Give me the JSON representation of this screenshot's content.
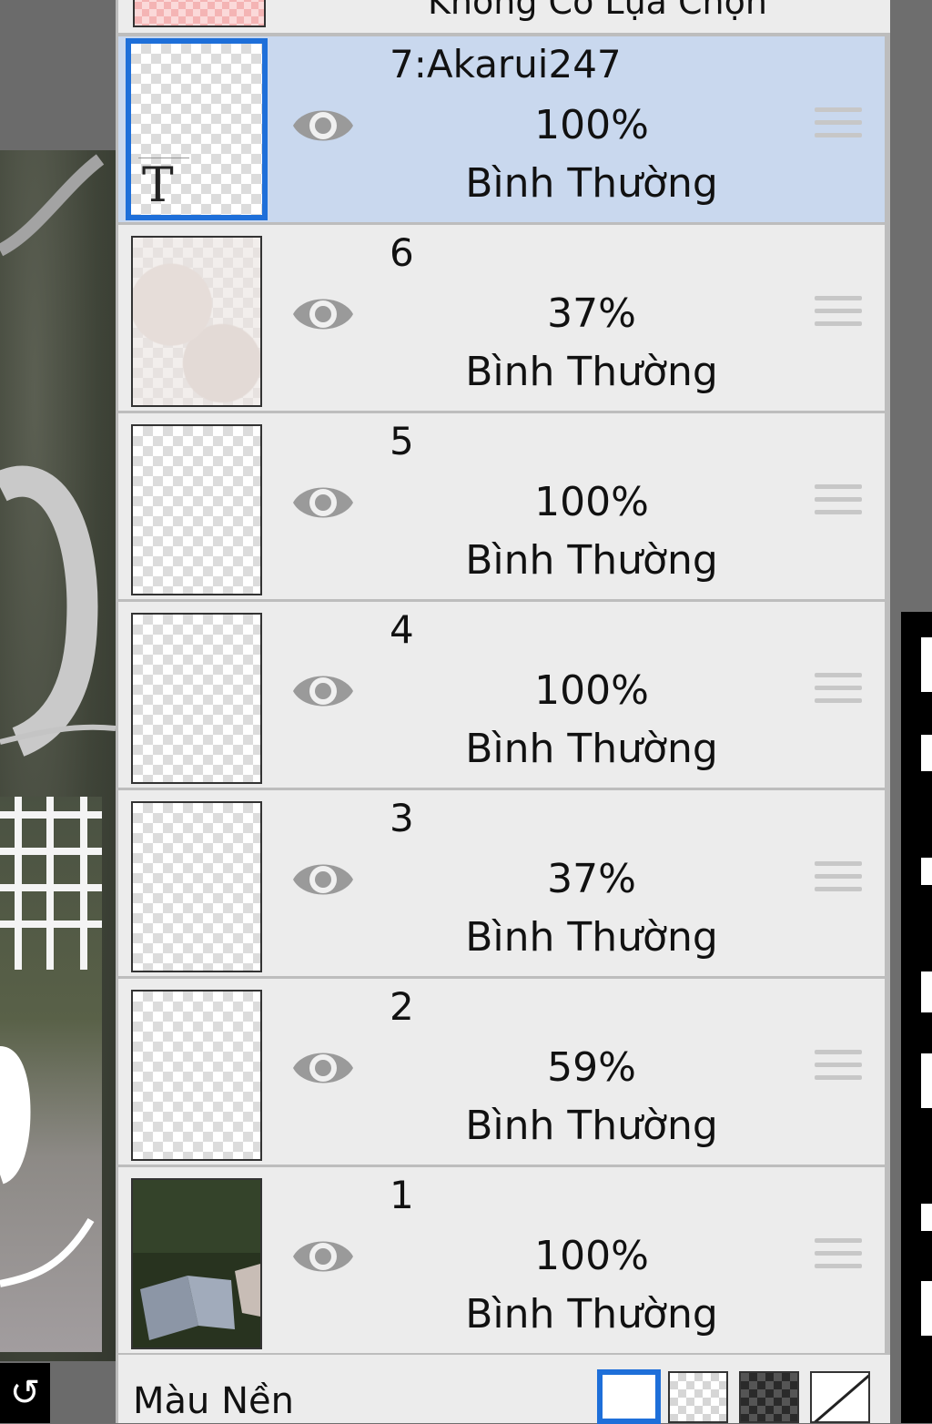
{
  "panel": {
    "selection_row_label": "Không Có Lựa Chọn",
    "layers": [
      {
        "name": "7:Akarui247",
        "opacity": "100%",
        "blend": "Bình Thường",
        "selected": true,
        "thumb": "text-icon",
        "thumb_letter": "T"
      },
      {
        "name": "6",
        "opacity": "37%",
        "blend": "Bình Thường",
        "selected": false,
        "thumb": "cloud"
      },
      {
        "name": "5",
        "opacity": "100%",
        "blend": "Bình Thường",
        "selected": false,
        "thumb": "transparent"
      },
      {
        "name": "4",
        "opacity": "100%",
        "blend": "Bình Thường",
        "selected": false,
        "thumb": "transparent"
      },
      {
        "name": "3",
        "opacity": "37%",
        "blend": "Bình Thường",
        "selected": false,
        "thumb": "transparent"
      },
      {
        "name": "2",
        "opacity": "59%",
        "blend": "Bình Thường",
        "selected": false,
        "thumb": "transparent"
      },
      {
        "name": "1",
        "opacity": "100%",
        "blend": "Bình Thường",
        "selected": false,
        "thumb": "photo"
      }
    ],
    "background_row": {
      "label": "Màu Nền",
      "swatches": [
        "white",
        "transparent",
        "dark-checker",
        "none"
      ],
      "selected_swatch": "white"
    }
  },
  "canvas": {
    "bottom_tab_icon": "undo-arrow-icon",
    "bottom_tab_glyph": "↺"
  },
  "colors": {
    "selected_row": "#c9d8ee",
    "row": "#ececec",
    "accent": "#1e6fd9",
    "eye": "#9a9a9a"
  }
}
